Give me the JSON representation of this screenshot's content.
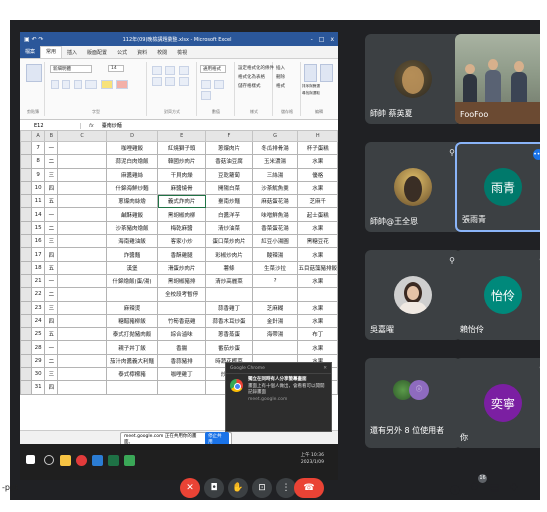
{
  "excel": {
    "title": "112年(09)晚檢講題彙整.xlsx - Microsoft Excel",
    "window_controls": [
      "-",
      "□",
      "x"
    ],
    "tabs": [
      "檔案",
      "常用",
      "插入",
      "版面配置",
      "公式",
      "資料",
      "校閱",
      "檢視"
    ],
    "ribbon": {
      "font_name": "新細明體",
      "font_size": "14",
      "number_format": "通用格式",
      "group_labels": [
        "剪貼簿",
        "字型",
        "對齊方式",
        "數值",
        "樣式",
        "儲存格",
        "編輯"
      ],
      "conditional": "設定格式化的條件",
      "table_format": "格式化為表格",
      "cell_style": "儲存格樣式",
      "insert": "插入",
      "delete": "刪除",
      "format": "格式",
      "sort": "排序與篩選",
      "find": "尋找與選取"
    },
    "name_box": "E12",
    "formula_icon": "fx",
    "formula": "臺南炒麵",
    "columns": [
      "",
      "A",
      "B",
      "C",
      "D",
      "E",
      "F",
      "G",
      "H"
    ],
    "rows": [
      [
        "7",
        "一",
        "",
        "咖哩雞飯",
        "紅燒獅子頭",
        "蔥爆肉片",
        "冬瓜排骨湯",
        "杯子蛋糕"
      ],
      [
        "8",
        "二",
        "",
        "蒜泥白肉燴飯",
        "韓國炒肉片",
        "香菇油豆腐",
        "玉米濃湯",
        "水果"
      ],
      [
        "9",
        "三",
        "",
        "麻醬雞絲",
        "干貝肉燥",
        "豆乾蘿蔔",
        "三絲湯",
        "優格"
      ],
      [
        "10",
        "四",
        "",
        "什錦海鮮炒麵",
        "麻醬燒骨",
        "開陽白菜",
        "沙茶魷魚羹",
        "水果"
      ],
      [
        "11",
        "五",
        "",
        "蔥爆肉絲燴",
        "義式炸肉片",
        "臺南炒麵",
        "麻菇蛋花湯",
        "芝麻千"
      ],
      [
        "14",
        "一",
        "",
        "鹹酥雞飯",
        "黑胡椒肉柳",
        "白醬洋芋",
        "味噌鮮魚湯",
        "起士蛋糕"
      ],
      [
        "15",
        "二",
        "",
        "沙茶豬肉燴飯",
        "梅乾麻醬",
        "清炒油菜",
        "香菜蛋花湯",
        "水果"
      ],
      [
        "16",
        "三",
        "",
        "海南雞油飯",
        "客家小炒",
        "蛋口菜炒肉片",
        "紅豆小湯圓",
        "黑糖豆花"
      ],
      [
        "17",
        "四",
        "",
        "炸醬麵",
        "香酥雞腿",
        "彩椒炒肉片",
        "酸辣湯",
        "水果"
      ],
      [
        "18",
        "五",
        "",
        "漢堡",
        "滑蛋炒肉片",
        "薯條",
        "生菜沙拉",
        "五目菇藻豬排飯"
      ],
      [
        "21",
        "一",
        "",
        "什錦燴飯(蛋/湯)",
        "黑胡椒豬排",
        "清炒高麗菜",
        "?",
        "水果"
      ],
      [
        "22",
        "二",
        "",
        "",
        "全校段考暫停",
        "",
        "",
        ""
      ],
      [
        "23",
        "三",
        "",
        "麻辣燙",
        "",
        "蒜香雞丁",
        "芝麻糊",
        "水果"
      ],
      [
        "24",
        "四",
        "",
        "糖醋豬柳飯",
        "竹筍香菇雞",
        "蒜香木耳炒蛋",
        "金針湯",
        "水果"
      ],
      [
        "25",
        "五",
        "",
        "泰式打拋豬肉飯",
        "綜合滷味",
        "蔥香蒸蛋",
        "海帶湯",
        "布丁"
      ],
      [
        "28",
        "一",
        "",
        "親子丼丁飯",
        "香腸",
        "番茄炒蛋",
        "",
        "水果"
      ],
      [
        "29",
        "二",
        "",
        "茄汁肉醬義大利麵",
        "香蒜豬排",
        "時蔬花椰菜",
        "",
        "水果"
      ],
      [
        "30",
        "三",
        "",
        "泰式檸檬豬",
        "咖哩雞丁",
        "炒青菜",
        "",
        "水果"
      ],
      [
        "31",
        "四",
        "",
        "",
        "",
        "",
        "",
        ""
      ]
    ]
  },
  "share_bar": {
    "text": "meet.google.com 正在共用你的畫面。",
    "button": "停止共用"
  },
  "notification": {
    "app": "Google Chrome",
    "title": "獨立在同時有人分享螢幕畫面",
    "body": "畫面上有十個人做出，會看看可以開開記錄畫面",
    "site": "meet.google.com"
  },
  "taskbar": {
    "time": "上午 10:36",
    "date": "2023/1/09"
  },
  "participants": [
    {
      "name": "師帥 蔡英夏"
    },
    {
      "name": "FooFoo"
    },
    {
      "name": "師帥@王全恩"
    },
    {
      "name": "張雨青",
      "initial": "雨青"
    },
    {
      "name": "吳嘉曜"
    },
    {
      "name": "賴怡伶",
      "initial": "怡伶"
    },
    {
      "name": "還有另外 8 位使用者"
    },
    {
      "name": "你",
      "initial": "奕寧"
    }
  ],
  "bottom": {
    "left_label": "-ppt",
    "participant_count": "16"
  },
  "colors": {
    "excel_blue": "#2b579a",
    "meet_dark": "#202124",
    "tile": "#3c4043",
    "hangup": "#ea4335",
    "avatar_teal": "#00796b",
    "avatar_purple": "#7b1fa2",
    "avatar_blue": "#1a73e8"
  }
}
